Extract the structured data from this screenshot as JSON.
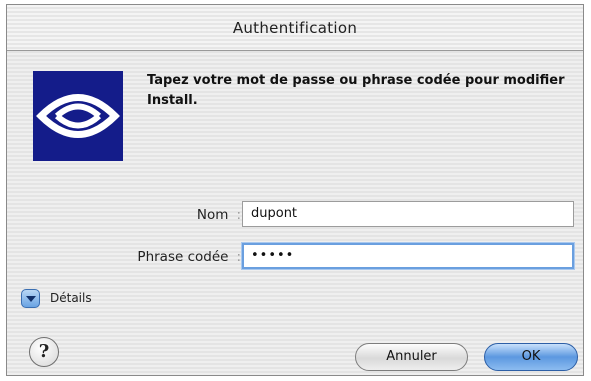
{
  "window": {
    "title": "Authentification"
  },
  "dialog": {
    "message": "Tapez votre mot de passe ou phrase codée pour modifier Install.",
    "logo_icon": "security-logo-icon",
    "fields": {
      "name_label": "Nom",
      "name_value": "dupont",
      "passphrase_label": "Phrase codée",
      "passphrase_value": "•••••",
      "colon": ":"
    },
    "details_label": "Détails",
    "help_glyph": "?",
    "buttons": {
      "cancel": "Annuler",
      "ok": "OK"
    },
    "colors": {
      "logo_bg": "#141c8a",
      "default_button": "#5c98e0",
      "focus_ring": "#6a9fdf"
    }
  }
}
